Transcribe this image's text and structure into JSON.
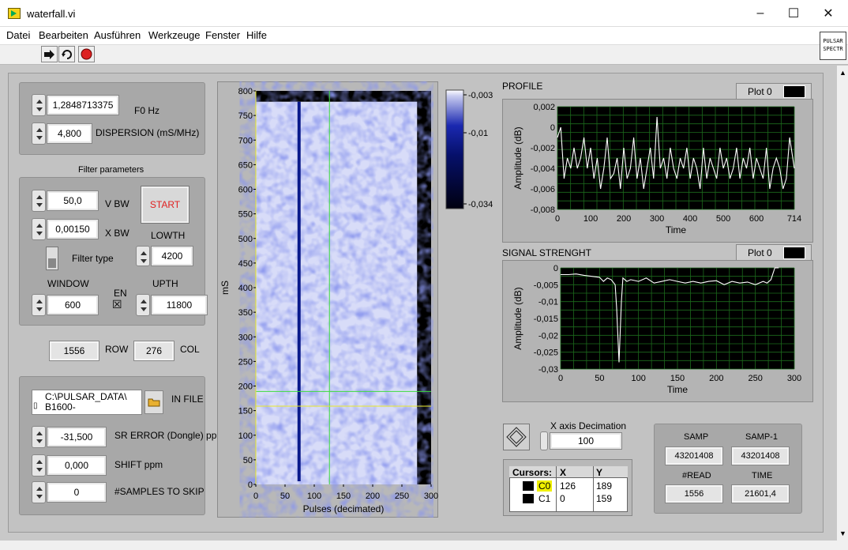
{
  "window": {
    "title": "waterfall.vi",
    "minimize": "–",
    "maximize": "☐",
    "close": "✕"
  },
  "menu": [
    "Datei",
    "Bearbeiten",
    "Ausführen",
    "Werkzeuge",
    "Fenster",
    "Hilfe"
  ],
  "toolbar_icons": [
    "run-arrow-icon",
    "run-continuously-icon",
    "abort-stop-icon"
  ],
  "vi_icon": {
    "line1": "PULSAR",
    "line2": "SPECTR"
  },
  "controls": {
    "f0": {
      "value": "1,2848713375",
      "label": "F0 Hz"
    },
    "dispersion": {
      "value": "4,800",
      "label": "DISPERSION (mS/MHz)"
    },
    "filter_title": "Filter parameters",
    "vbw": {
      "value": "50,0",
      "label": "V BW"
    },
    "xbw": {
      "value": "0,00150",
      "label": "X BW"
    },
    "start_label": "START",
    "lowth": {
      "label": "LOWTH",
      "value": "4200"
    },
    "filter_type": "Filter type",
    "window": {
      "label": "WINDOW",
      "value": "600"
    },
    "en": {
      "label": "EN",
      "checked": "☒"
    },
    "upth": {
      "label": "UPTH",
      "value": "11800"
    },
    "row": {
      "value": "1556",
      "label": "ROW"
    },
    "col": {
      "value": "276",
      "label": "COL"
    },
    "infile": {
      "line1": "C:\\PULSAR_DATA\\",
      "line2": "B1600-",
      "label": "IN FILE"
    },
    "sr_error": {
      "value": "-31,500",
      "label": "SR ERROR (Dongle) ppm"
    },
    "shift": {
      "value": "0,000",
      "label": "SHIFT ppm"
    },
    "skip": {
      "value": "0",
      "label": "#SAMPLES TO SKIP"
    }
  },
  "waterfall": {
    "ylabel": "mS",
    "xlabel": "Pulses (decimated)",
    "yticks": [
      "800",
      "750",
      "700",
      "650",
      "600",
      "550",
      "500",
      "450",
      "400",
      "350",
      "300",
      "250",
      "200",
      "150",
      "100",
      "50",
      "0"
    ],
    "xticks": [
      "0",
      "50",
      "100",
      "150",
      "200",
      "250",
      "300"
    ],
    "colorbar_ticks": [
      "-0,003",
      "-0,01",
      "-0,034"
    ]
  },
  "profile": {
    "title": "PROFILE",
    "plot_legend": "Plot 0",
    "xlabel": "Time",
    "ylabel": "Amplitude (dB)",
    "yticks": [
      "0,002",
      "0",
      "-0,002",
      "-0,004",
      "-0,006",
      "-0,008"
    ],
    "xticks": [
      "0",
      "100",
      "200",
      "300",
      "400",
      "500",
      "600",
      "714"
    ]
  },
  "signal": {
    "title": "SIGNAL STRENGHT",
    "plot_legend": "Plot 0",
    "xlabel": "Time",
    "ylabel": "Amplitude (dB)",
    "yticks": [
      "0",
      "-0,005",
      "-0,01",
      "-0,015",
      "-0,02",
      "-0,025",
      "-0,03"
    ],
    "xticks": [
      "0",
      "50",
      "100",
      "150",
      "200",
      "250",
      "300"
    ]
  },
  "decimation": {
    "label": "X axis Decimation",
    "value": "100"
  },
  "cursors": {
    "headers": [
      "Cursors:",
      "X",
      "Y"
    ],
    "rows": [
      {
        "name": "C0",
        "x": "126",
        "y": "189"
      },
      {
        "name": "C1",
        "x": "0",
        "y": "159"
      }
    ]
  },
  "stats": {
    "samp_label": "SAMP",
    "samp": "43201408",
    "samp1_label": "SAMP-1",
    "samp1": "43201408",
    "read_label": "#READ",
    "read": "1556",
    "time_label": "TIME",
    "time": "21601,4"
  },
  "chart_data": [
    {
      "type": "heatmap",
      "title": "",
      "xlabel": "Pulses (decimated)",
      "ylabel": "mS",
      "xlim": [
        0,
        300
      ],
      "ylim": [
        0,
        800
      ],
      "colorbar": [
        -0.034,
        -0.01,
        -0.003
      ],
      "cursors": [
        {
          "name": "C0",
          "x": 126,
          "y": 189
        },
        {
          "name": "C1",
          "x": 0,
          "y": 159
        }
      ],
      "pulse_line_x": 74
    },
    {
      "type": "line",
      "title": "PROFILE",
      "xlabel": "Time",
      "ylabel": "Amplitude (dB)",
      "xlim": [
        0,
        714
      ],
      "ylim": [
        -0.008,
        0.002
      ],
      "series": [
        {
          "name": "Plot 0",
          "x": [
            0,
            10,
            20,
            30,
            40,
            50,
            60,
            70,
            80,
            90,
            100,
            110,
            120,
            130,
            140,
            150,
            160,
            170,
            180,
            190,
            200,
            210,
            220,
            230,
            240,
            250,
            260,
            270,
            280,
            290,
            300,
            310,
            320,
            330,
            340,
            350,
            360,
            370,
            380,
            390,
            400,
            410,
            420,
            430,
            440,
            450,
            460,
            470,
            480,
            490,
            500,
            510,
            520,
            530,
            540,
            550,
            560,
            570,
            580,
            590,
            600,
            610,
            620,
            630,
            640,
            650,
            660,
            670,
            680,
            690,
            700,
            714
          ],
          "values": [
            -0.001,
            0.0,
            -0.005,
            -0.003,
            -0.004,
            -0.002,
            -0.004,
            -0.003,
            -0.001,
            -0.004,
            -0.002,
            -0.005,
            -0.003,
            -0.006,
            -0.004,
            -0.001,
            -0.005,
            -0.0045,
            -0.003,
            -0.006,
            -0.002,
            -0.005,
            -0.004,
            -0.001,
            -0.005,
            -0.003,
            -0.006,
            -0.004,
            -0.002,
            -0.005,
            0.001,
            -0.004,
            -0.003,
            -0.005,
            -0.002,
            -0.004,
            -0.005,
            -0.003,
            -0.004,
            -0.002,
            -0.005,
            -0.003,
            -0.004,
            -0.006,
            -0.002,
            -0.005,
            -0.003,
            -0.004,
            -0.005,
            -0.002,
            -0.004,
            -0.003,
            -0.005,
            -0.004,
            -0.002,
            -0.005,
            -0.003,
            -0.004,
            -0.002,
            -0.005,
            -0.003,
            -0.004,
            -0.005,
            -0.002,
            -0.006,
            -0.004,
            -0.003,
            -0.004,
            -0.006,
            -0.005,
            -0.001,
            -0.004
          ]
        }
      ]
    },
    {
      "type": "line",
      "title": "SIGNAL STRENGHT",
      "xlabel": "Time",
      "ylabel": "Amplitude (dB)",
      "xlim": [
        0,
        300
      ],
      "ylim": [
        -0.03,
        0
      ],
      "series": [
        {
          "name": "Plot 0",
          "x": [
            0,
            10,
            20,
            30,
            40,
            50,
            55,
            60,
            65,
            70,
            72,
            75,
            78,
            80,
            85,
            90,
            100,
            110,
            120,
            130,
            140,
            150,
            160,
            170,
            180,
            190,
            200,
            210,
            220,
            230,
            240,
            250,
            260,
            265,
            270,
            275,
            280
          ],
          "values": [
            -0.002,
            -0.002,
            -0.0018,
            -0.0022,
            -0.0025,
            -0.0028,
            -0.004,
            -0.003,
            -0.0035,
            -0.005,
            -0.012,
            -0.028,
            -0.01,
            -0.003,
            -0.004,
            -0.0035,
            -0.004,
            -0.003,
            -0.0045,
            -0.004,
            -0.0035,
            -0.004,
            -0.0045,
            -0.004,
            -0.0045,
            -0.004,
            -0.0038,
            -0.005,
            -0.004,
            -0.0045,
            -0.0042,
            -0.005,
            -0.004,
            -0.0045,
            -0.0035,
            0.0,
            0.0
          ]
        }
      ]
    }
  ]
}
